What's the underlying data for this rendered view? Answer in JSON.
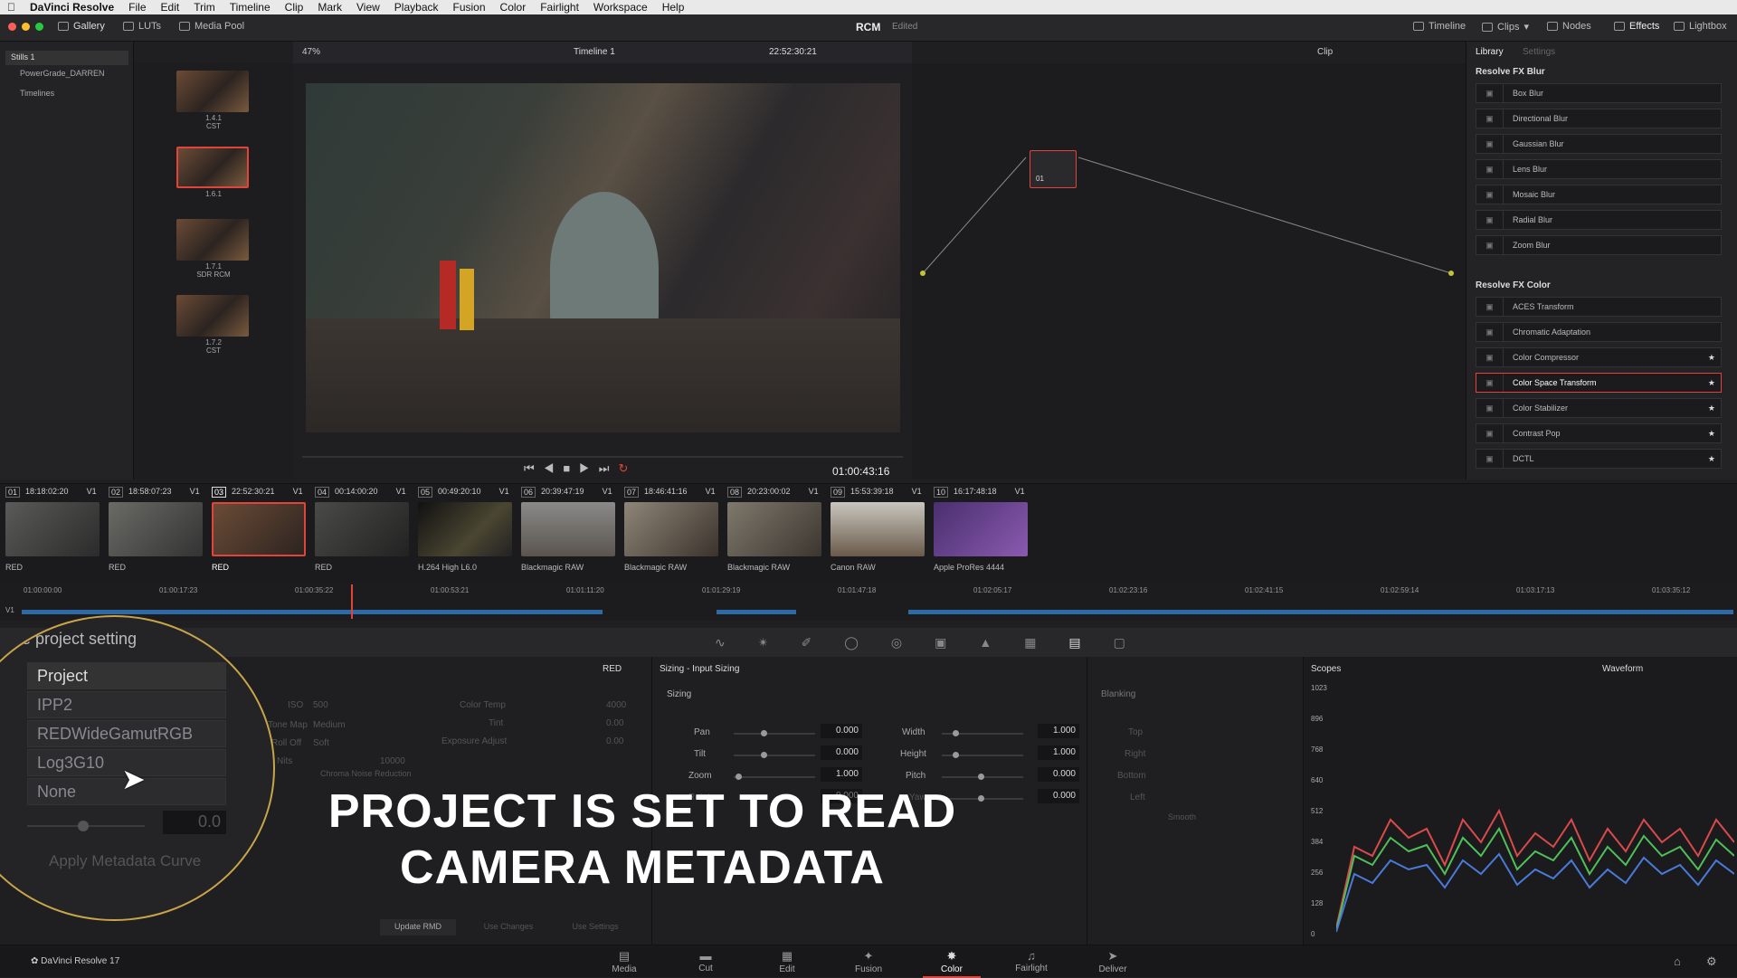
{
  "menubar": {
    "app": "DaVinci Resolve",
    "items": [
      "File",
      "Edit",
      "Trim",
      "Timeline",
      "Clip",
      "Mark",
      "View",
      "Playback",
      "Fusion",
      "Color",
      "Fairlight",
      "Workspace",
      "Help"
    ]
  },
  "toolbar": {
    "gallery": "Gallery",
    "luts": "LUTs",
    "media_pool": "Media Pool",
    "project": "RCM",
    "status": "Edited",
    "timeline": "Timeline",
    "clips": "Clips",
    "nodes": "Nodes",
    "effects": "Effects",
    "lightbox": "Lightbox"
  },
  "leftpanel": {
    "items": [
      "Stills 1",
      "PowerGrade_DARREN",
      "Timelines"
    ]
  },
  "gallery": {
    "stills": [
      {
        "label": "1.4.1",
        "sub": "CST"
      },
      {
        "label": "1.6.1",
        "sub": ""
      },
      {
        "label": "1.7.1",
        "sub": "SDR RCM"
      },
      {
        "label": "1.7.2",
        "sub": "CST"
      }
    ]
  },
  "viewer": {
    "zoom": "47%",
    "timeline_name": "Timeline 1",
    "timecode": "22:52:30:21",
    "clip_mode": "Clip",
    "playhead_tc": "01:00:43:16"
  },
  "nodes": {
    "node_label": "01"
  },
  "library": {
    "tab_library": "Library",
    "tab_settings": "Settings",
    "sec_blur": "Resolve FX Blur",
    "blur": [
      "Box Blur",
      "Directional Blur",
      "Gaussian Blur",
      "Lens Blur",
      "Mosaic Blur",
      "Radial Blur",
      "Zoom Blur"
    ],
    "sec_color": "Resolve FX Color",
    "color": [
      "ACES Transform",
      "Chromatic Adaptation",
      "Color Compressor",
      "Color Space Transform",
      "Color Stabilizer",
      "Contrast Pop",
      "DCTL"
    ]
  },
  "clips": [
    {
      "num": "01",
      "tc": "18:18:02:20",
      "track": "V1",
      "codec": "RED"
    },
    {
      "num": "02",
      "tc": "18:58:07:23",
      "track": "V1",
      "codec": "RED"
    },
    {
      "num": "03",
      "tc": "22:52:30:21",
      "track": "V1",
      "codec": "RED"
    },
    {
      "num": "04",
      "tc": "00:14:00:20",
      "track": "V1",
      "codec": "RED"
    },
    {
      "num": "05",
      "tc": "00:49:20:10",
      "track": "V1",
      "codec": "H.264 High L6.0"
    },
    {
      "num": "06",
      "tc": "20:39:47:19",
      "track": "V1",
      "codec": "Blackmagic RAW"
    },
    {
      "num": "07",
      "tc": "18:46:41:16",
      "track": "V1",
      "codec": "Blackmagic RAW"
    },
    {
      "num": "08",
      "tc": "20:23:00:02",
      "track": "V1",
      "codec": "Blackmagic RAW"
    },
    {
      "num": "09",
      "tc": "15:53:39:18",
      "track": "V1",
      "codec": "Canon RAW"
    },
    {
      "num": "10",
      "tc": "16:17:48:18",
      "track": "V1",
      "codec": "Apple ProRes 4444"
    }
  ],
  "ruler": [
    "01:00:00:00",
    "01:00:17:23",
    "01:00:35:22",
    "01:00:53:21",
    "01:01:11:20",
    "01:01:29:19",
    "01:01:47:18",
    "01:02:05:17",
    "01:02:23:16",
    "01:02:41:15",
    "01:02:59:14",
    "01:03:17:13",
    "01:03:35:12"
  ],
  "ruler_track": "V1",
  "camera_raw": {
    "title": "e project setting",
    "decode": "RED",
    "fields": [
      {
        "label": "ISO",
        "value": "500"
      },
      {
        "label": "Tone Map",
        "value": "Medium"
      },
      {
        "label": "Roll Off",
        "value": "Soft"
      },
      {
        "label": "Color Temp",
        "value": "4000"
      },
      {
        "label": "Tint",
        "value": "0.00"
      },
      {
        "label": "Exposure Adjust",
        "value": "0.00"
      },
      {
        "label": "Nits",
        "value": "10000"
      }
    ],
    "chroma_nr": "Chroma Noise Reduction",
    "update_rmd": "Update RMD",
    "use_changes": "Use Changes",
    "use_settings": "Use Settings"
  },
  "zoom_circle": {
    "header": "e project setting",
    "items": [
      "Project",
      "IPP2",
      "REDWideGamutRGB",
      "Log3G10",
      "None"
    ],
    "value": "0.0",
    "apply": "Apply Metadata Curve"
  },
  "sizing": {
    "title": "Sizing - Input Sizing",
    "section": "Sizing",
    "blanking": "Blanking",
    "left": [
      {
        "label": "Pan",
        "value": "0.000"
      },
      {
        "label": "Tilt",
        "value": "0.000"
      },
      {
        "label": "Zoom",
        "value": "1.000"
      },
      {
        "label": "Rotate",
        "value": "0.000"
      }
    ],
    "right": [
      {
        "label": "Width",
        "value": "1.000"
      },
      {
        "label": "Height",
        "value": "1.000"
      },
      {
        "label": "Pitch",
        "value": "0.000"
      },
      {
        "label": "Yaw",
        "value": "0.000"
      }
    ],
    "blank": [
      "Top",
      "Right",
      "Bottom",
      "Left"
    ],
    "smooth": "Smooth"
  },
  "scopes": {
    "title": "Scopes",
    "mode": "Waveform",
    "ticks": [
      "1023",
      "896",
      "768",
      "640",
      "512",
      "384",
      "256",
      "128",
      "0"
    ]
  },
  "caption": {
    "line1": "PROJECT IS SET TO READ",
    "line2": "CAMERA METADATA"
  },
  "pages": {
    "brand": "DaVinci Resolve 17",
    "items": [
      "Media",
      "Cut",
      "Edit",
      "Fusion",
      "Color",
      "Fairlight",
      "Deliver"
    ],
    "active": "Color"
  },
  "colors": {
    "accent": "#e0443a",
    "circle": "#c9a54a"
  }
}
